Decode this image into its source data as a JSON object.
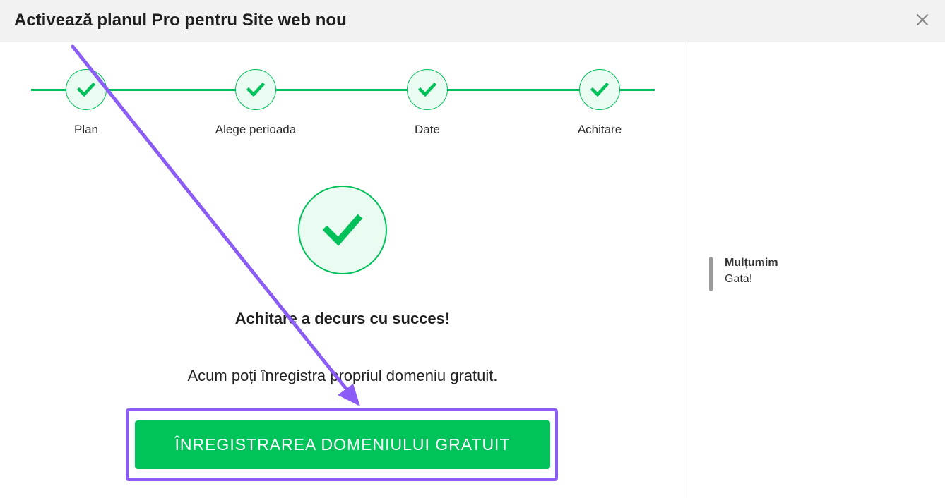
{
  "header": {
    "title": "Activează planul Pro pentru Site web nou",
    "close_icon": "close-icon"
  },
  "stepper": {
    "steps": [
      {
        "label": "Plan",
        "status": "done"
      },
      {
        "label": "Alege perioada",
        "status": "done"
      },
      {
        "label": "Date",
        "status": "done"
      },
      {
        "label": "Achitare",
        "status": "done"
      }
    ],
    "step_icon": "check-icon"
  },
  "main": {
    "success_icon": "check-circle-icon",
    "title": "Achitare a decurs cu succes!",
    "subtitle": "Acum poți înregistra propriul domeniu gratuit.",
    "cta_label": "ÎNREGISTRAREA DOMENIULUI GRATUIT"
  },
  "sidebar": {
    "title": "Mulțumim",
    "text": "Gata!"
  },
  "colors": {
    "accent_green": "#00c35a",
    "annotation_purple": "#8b5cf6",
    "header_bg": "#f2f2f2"
  }
}
